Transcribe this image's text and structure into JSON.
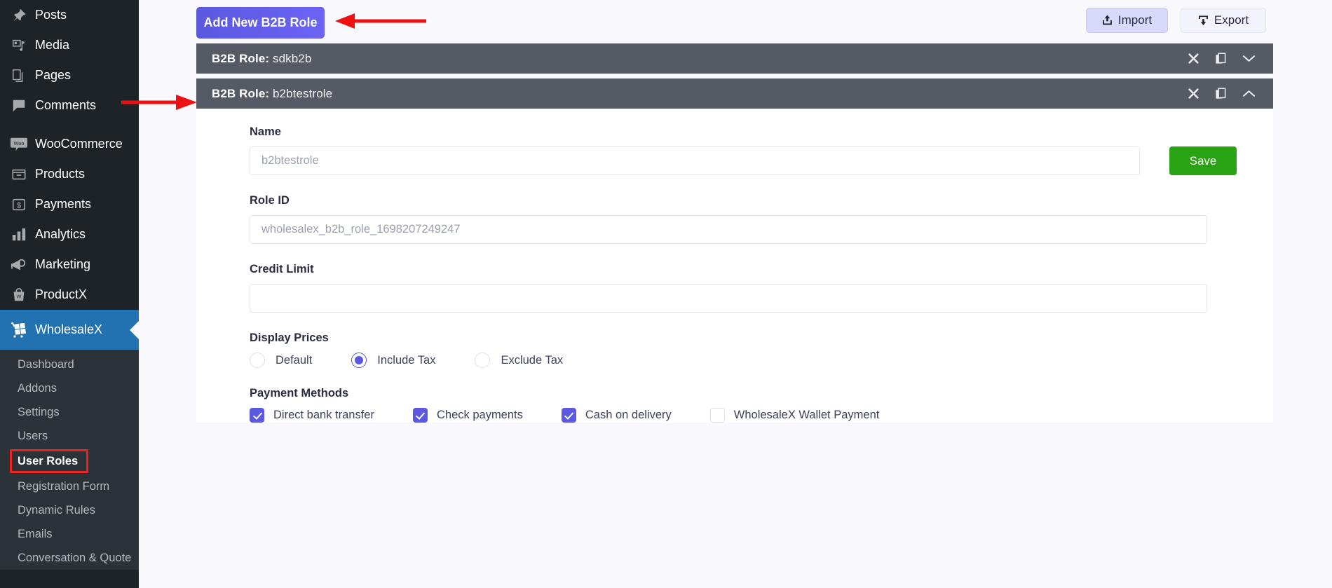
{
  "sidebar": {
    "items": [
      {
        "label": "Posts",
        "icon": "pin-icon"
      },
      {
        "label": "Media",
        "icon": "media-icon"
      },
      {
        "label": "Pages",
        "icon": "pages-icon"
      },
      {
        "label": "Comments",
        "icon": "comment-icon"
      },
      {
        "label": "WooCommerce",
        "icon": "woo-icon"
      },
      {
        "label": "Products",
        "icon": "products-icon"
      },
      {
        "label": "Payments",
        "icon": "payments-icon"
      },
      {
        "label": "Analytics",
        "icon": "analytics-icon"
      },
      {
        "label": "Marketing",
        "icon": "marketing-icon"
      },
      {
        "label": "ProductX",
        "icon": "productx-icon"
      }
    ],
    "active_item": {
      "label": "WholesaleX",
      "icon": "wholesalex-icon"
    },
    "submenu": [
      {
        "label": "Dashboard"
      },
      {
        "label": "Addons"
      },
      {
        "label": "Settings"
      },
      {
        "label": "Users"
      },
      {
        "label": "User Roles"
      },
      {
        "label": "Registration Form"
      },
      {
        "label": "Dynamic Rules"
      },
      {
        "label": "Emails"
      },
      {
        "label": "Conversation & Quote"
      }
    ],
    "active_submenu": "User Roles",
    "accent_blue": "#2271b1",
    "highlight_box_color": "#ee2222"
  },
  "toolbar": {
    "add_role_label": "Add New B2B Role",
    "import_label": "Import",
    "export_label": "Export",
    "add_role_color": "#5a59e0"
  },
  "roles": [
    {
      "prefix": "B2B Role:",
      "name": "sdkb2b",
      "expanded": false,
      "chevron": "chevron-down-icon"
    },
    {
      "prefix": "B2B Role:",
      "name": "b2btestrole",
      "expanded": true,
      "chevron": "chevron-up-icon"
    }
  ],
  "form": {
    "name_label": "Name",
    "name_value": "b2btestrole",
    "save_label": "Save",
    "save_color": "#29a213",
    "role_id_label": "Role ID",
    "role_id_value": "wholesalex_b2b_role_1698207249247",
    "credit_limit_label": "Credit Limit",
    "credit_limit_value": "",
    "display_prices_label": "Display Prices",
    "display_prices_options": [
      {
        "label": "Default",
        "selected": false
      },
      {
        "label": "Include Tax",
        "selected": true
      },
      {
        "label": "Exclude Tax",
        "selected": false
      }
    ],
    "payment_methods_label": "Payment Methods",
    "payment_methods": [
      {
        "label": "Direct bank transfer",
        "checked": true
      },
      {
        "label": "Check payments",
        "checked": true
      },
      {
        "label": "Cash on delivery",
        "checked": true
      },
      {
        "label": "WholesaleX Wallet Payment",
        "checked": false
      }
    ]
  }
}
